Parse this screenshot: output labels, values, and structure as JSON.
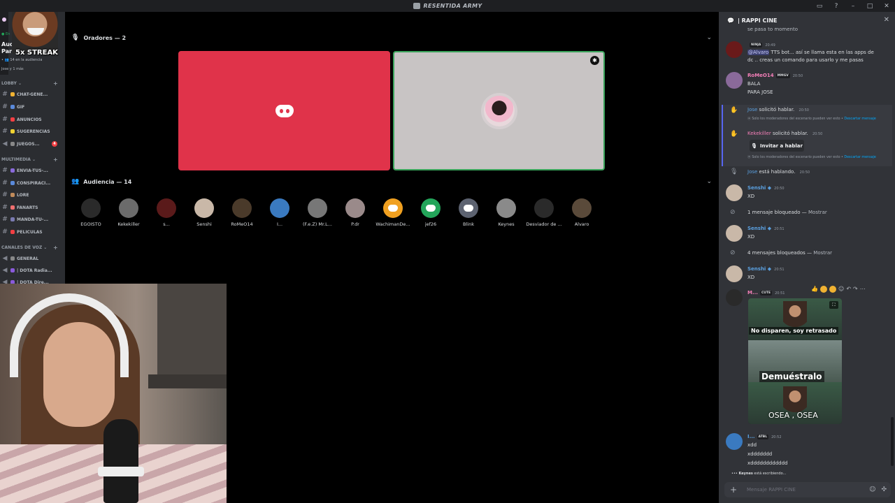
{
  "window": {
    "title": "RESENTIDA ARMY"
  },
  "sidebar": {
    "streak_label": "5x STREAK",
    "audience_name": "Aud",
    "audience_name2": "Parch",
    "audience_sub": "14 en la audiencia",
    "audience_sub2": "Jose y 1 más",
    "categories": [
      {
        "label": "LOBBY"
      },
      {
        "label": "MULTIMEDIA"
      },
      {
        "label": "CANALES DE VOZ"
      }
    ],
    "lobby_channels": [
      {
        "label": "CHAT-GENE..."
      },
      {
        "label": "GIF"
      },
      {
        "label": "ANUNCIOS"
      },
      {
        "label": "SUGERENCIAS"
      },
      {
        "label": "JUEGOS...",
        "badge": "4"
      }
    ],
    "multimedia_channels": [
      {
        "label": "ENVIA-TUS-..."
      },
      {
        "label": "CONSPIRACI..."
      },
      {
        "label": "LORE"
      },
      {
        "label": "FANARTS"
      },
      {
        "label": "MANDA-TU-..."
      },
      {
        "label": "PELICULAS"
      }
    ],
    "voice_channels": [
      {
        "label": "GENERAL"
      },
      {
        "label": "| DOTA Radia..."
      },
      {
        "label": "| DOTA Dire..."
      }
    ]
  },
  "stage": {
    "speakers_label": "Oradores — 2",
    "audience_label": "Audiencia — 14",
    "audience": [
      {
        "name": "EGOISTO",
        "color": "#2a2a2a"
      },
      {
        "name": "Kekekiller",
        "color": "#6b6b6b"
      },
      {
        "name": "s...",
        "color": "#5a1a1a"
      },
      {
        "name": "Senshi",
        "color": "#c9b8a8"
      },
      {
        "name": "RoMeO14",
        "color": "#4a3a2a"
      },
      {
        "name": "I...",
        "color": "#3a7ac0"
      },
      {
        "name": "(F.e.Z) Mr.L...",
        "color": "#777777"
      },
      {
        "name": "P.dr",
        "color": "#9a8a8a"
      },
      {
        "name": "WachimanDe...",
        "color": "#f0a020",
        "discord": true
      },
      {
        "name": "jef26",
        "color": "#23a55a",
        "discord": true
      },
      {
        "name": "Blink",
        "color": "#5c6270",
        "discord": true
      },
      {
        "name": "Keynes",
        "color": "#8a8a8a"
      },
      {
        "name": "Desviador de ...",
        "color": "#2a2a2a"
      },
      {
        "name": "Alvaro",
        "color": "#5a4a3a"
      }
    ]
  },
  "chat": {
    "channel_name": "| RAPPI CINE",
    "top_cut": "se pasa to momento",
    "messages": [
      {
        "name": "",
        "tag": "NINJA",
        "time": "20:49",
        "lines": [
          "TTS bot... así se llama esta en las apps de",
          "dc .. creas un comando para usarlo y me pasas"
        ],
        "mention": "@Alvaro"
      },
      {
        "name": "RoMeO14",
        "tag": "MMGV",
        "time": "20:50",
        "lines": [
          "BALA",
          "PARA JOSE"
        ]
      }
    ],
    "system": {
      "jose_request": "solicitó hablar.",
      "jose_name": "Jose",
      "keke_name": "Kekekiller",
      "keke_request": "solicitó hablar.",
      "time1": "20:50",
      "note": "Solo los moderadores del escenario pueden ver esto •",
      "note_link": "Descartar mensaje",
      "invite_label": "Invitar a hablar",
      "speaking_name": "Jose",
      "speaking_text": "está hablando.",
      "speaking_time": "20:50"
    },
    "senshi": {
      "name": "Senshi",
      "text": "XD",
      "t1": "20:50",
      "t2": "20:51",
      "t3": "20:51"
    },
    "blocked1": "1 mensaje bloqueado —",
    "blocked2": "4 mensajes bloqueados —",
    "show": "Mostrar",
    "meme_author": {
      "name": "M...",
      "tag": "CUTE",
      "time": "20:51"
    },
    "meme": {
      "cap1": "No disparen, soy retrasado",
      "cap2": "Demuéstralo",
      "cap3": "OSEA , OSEA"
    },
    "last": {
      "name": "I...",
      "tag": "ATBL",
      "time": "20:52",
      "lines": [
        "xdd",
        "xddddddd",
        "xdddddddddddd"
      ]
    },
    "typing_name": "Keynes",
    "typing_text": "está escribiendo...",
    "composer_placeholder": "Mensaje  RAPPI CINE"
  }
}
